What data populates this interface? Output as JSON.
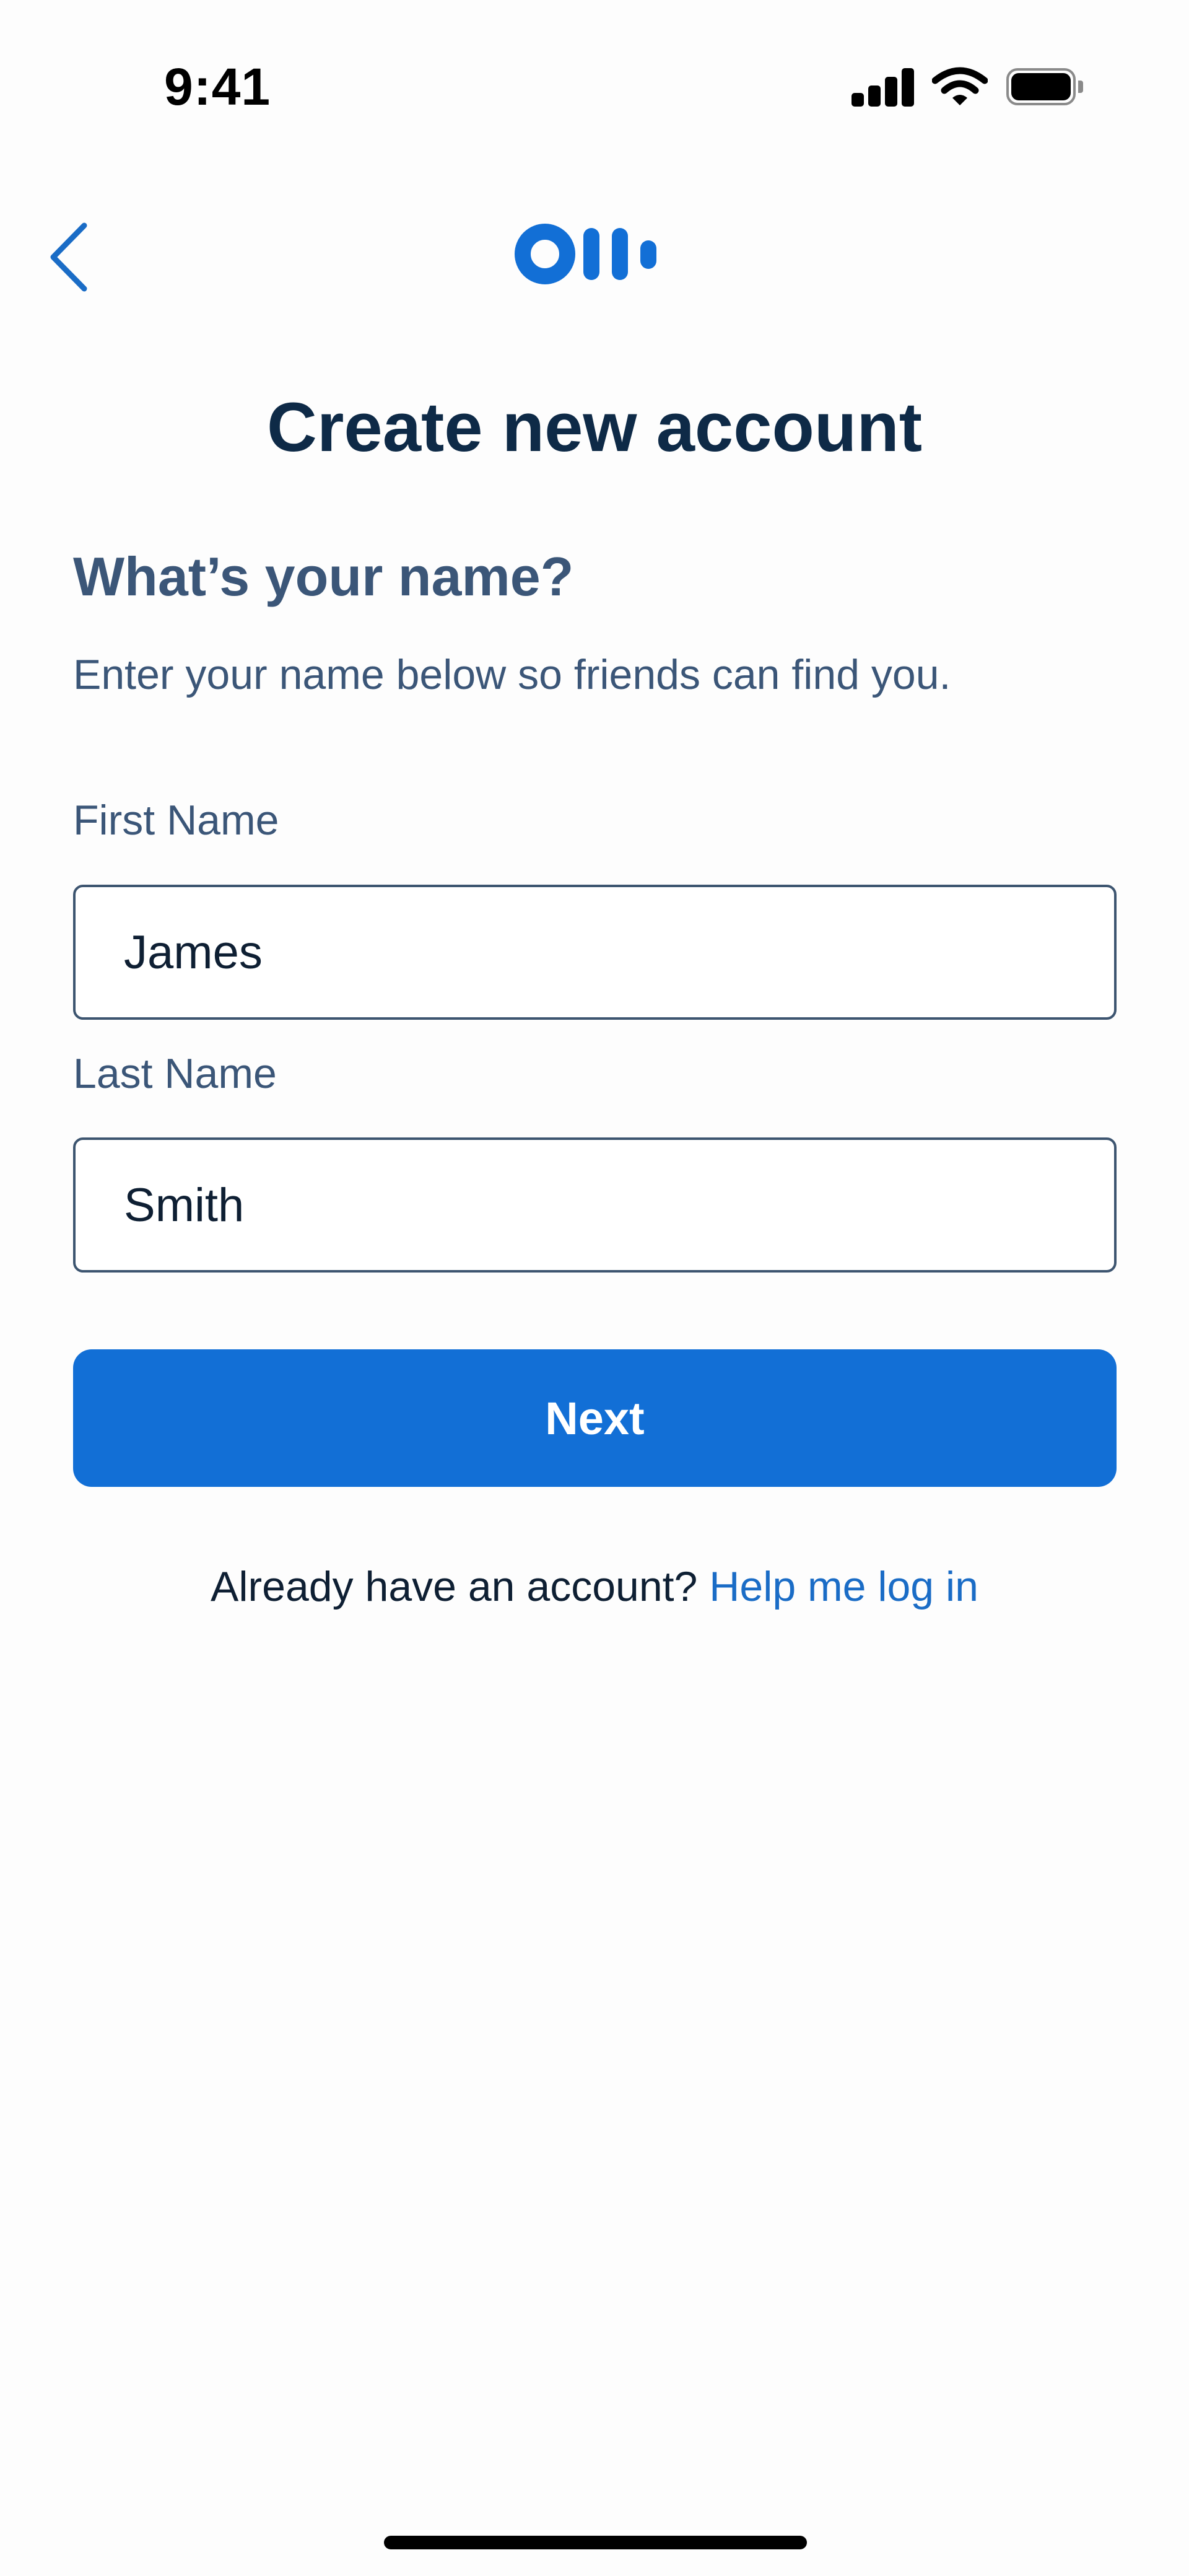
{
  "status_bar": {
    "time": "9:41"
  },
  "header": {
    "back_icon": "chevron-left-icon",
    "logo": "otter-logo"
  },
  "page": {
    "title": "Create new account",
    "heading": "What’s your name?",
    "subheading": "Enter your name below so friends can find you."
  },
  "form": {
    "first_name_label": "First Name",
    "first_name_value": "James",
    "last_name_label": "Last Name",
    "last_name_value": "Smith",
    "next_label": "Next"
  },
  "footer": {
    "prompt": "Already have an account?",
    "link": "Help me log in"
  },
  "colors": {
    "brand_blue": "#126fd6",
    "title": "#0e2a47",
    "secondary_text": "#3b5678",
    "link": "#1a6cc6"
  }
}
